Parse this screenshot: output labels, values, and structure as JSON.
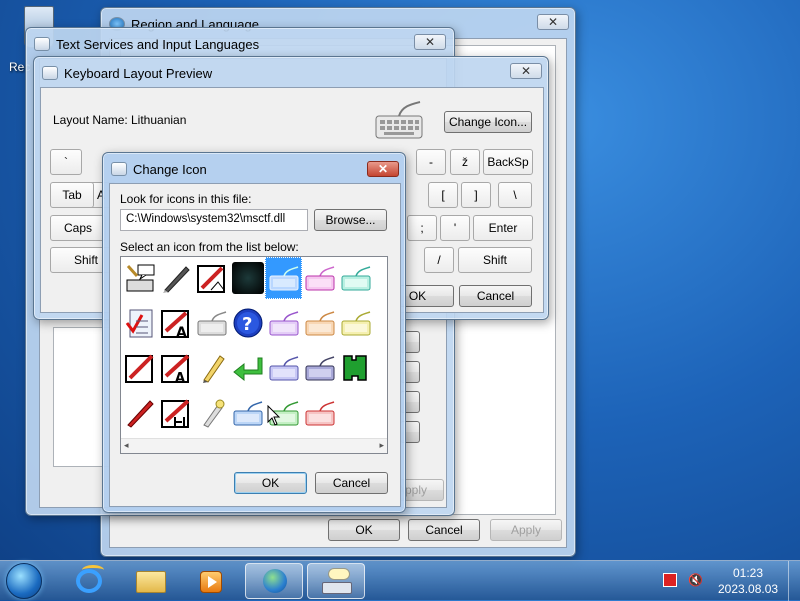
{
  "desktop": {
    "recycle_bin_label": "Rec"
  },
  "region_window": {
    "title": "Region and Language",
    "close": "✕",
    "ok": "OK",
    "cancel": "Cancel",
    "apply": "Apply"
  },
  "text_services_window": {
    "title": "Text Services and Input Languages",
    "close": "✕",
    "apply": "Apply"
  },
  "keyboard_preview": {
    "title": "Keyboard Layout Preview",
    "close": "✕",
    "layout_name_label": "Layout Name:",
    "layout_name_value": "Lithuanian",
    "change_icon_button": "Change Icon...",
    "keys": {
      "backtick": "`",
      "a_partial": "A",
      "minus": "-",
      "z_caron": "ž",
      "backspace": "BackSp",
      "tab": "Tab",
      "bracket_left": "[",
      "bracket_right": "]",
      "backslash": "\\",
      "caps": "Caps",
      "semicolon": ";",
      "quote": "'",
      "enter": "Enter",
      "shift_left": "Shift",
      "slash": "/",
      "shift_right": "Shift"
    },
    "ok": "OK",
    "cancel": "Cancel"
  },
  "change_icon_dialog": {
    "title": "Change Icon",
    "close": "✕",
    "look_for_label": "Look for icons in this file:",
    "file_path": "C:\\Windows\\system32\\msctf.dll",
    "browse_button": "Browse...",
    "select_label": "Select an icon from the list below:",
    "ok": "OK",
    "cancel": "Cancel",
    "selected_icon_index": 4,
    "icons": [
      "keyboard-speech-icon",
      "pen-icon",
      "handwriting-pad-icon",
      "black-square-icon",
      "keyboard-blue-icon",
      "keyboard-magenta-icon",
      "keyboard-teal-icon",
      "checklist-icon",
      "handwriting-a-icon",
      "keyboard-gray-icon",
      "help-icon",
      "keyboard-purple-icon",
      "keyboard-orange-icon",
      "keyboard-yellow-icon",
      "pen-pad-icon",
      "pen-pad-a-icon",
      "pencil-icon",
      "green-arrow-icon",
      "keyboard-violet-icon",
      "keyboard-dark-purple-icon",
      "green-puzzle-icon",
      "red-pen-icon",
      "handwriting-jp-icon",
      "pencil-eraser-icon",
      "keyboard-blue2-icon",
      "keyboard-green-icon",
      "keyboard-red-icon"
    ]
  },
  "taskbar": {
    "start": "start-orb-icon",
    "items": [
      "internet-explorer-icon",
      "explorer-folder-icon",
      "media-player-icon",
      "region-globe-icon",
      "keyboard-icon"
    ],
    "time": "01:23",
    "date": "2023.08.03"
  },
  "colors": {
    "selection": "#3399ff",
    "title_text": "#000000"
  }
}
